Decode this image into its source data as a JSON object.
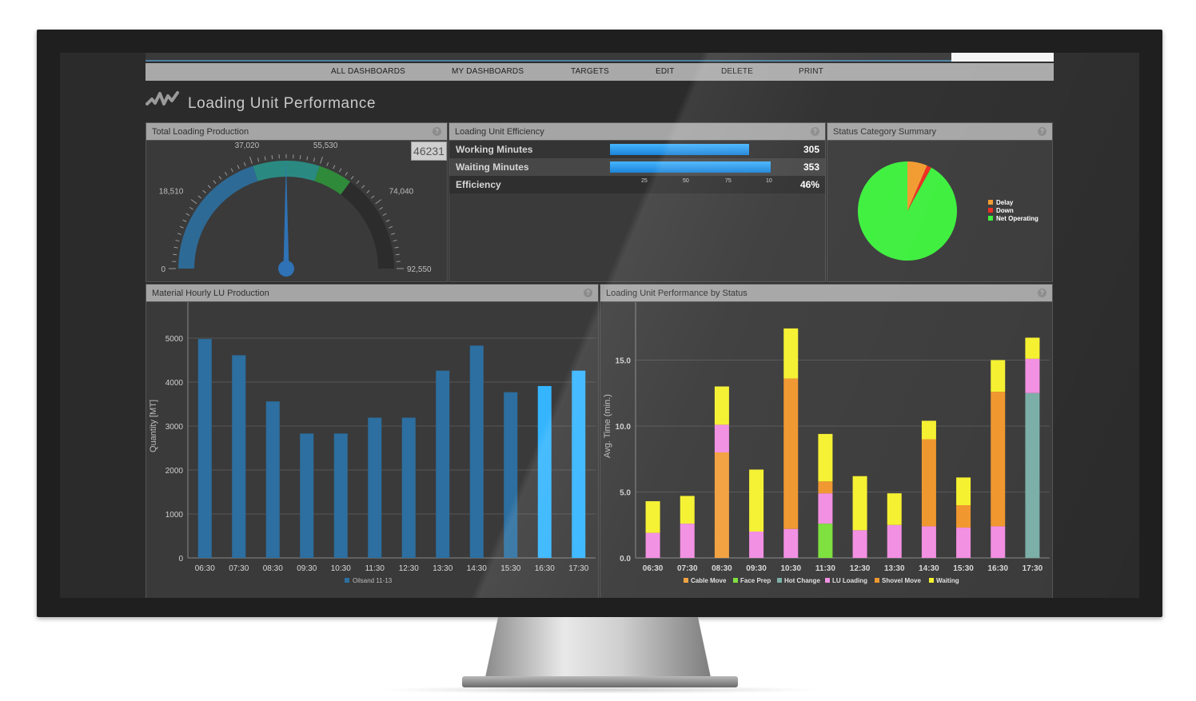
{
  "nav": {
    "items": [
      "ALL DASHBOARDS",
      "MY DASHBOARDS",
      "TARGETS",
      "EDIT",
      "DELETE",
      "PRINT"
    ]
  },
  "page": {
    "title": "Loading Unit Performance"
  },
  "icons": {
    "help": "?",
    "logo": "wave-logo-icon"
  },
  "colors": {
    "bar_blue": "#2c6fa0",
    "bar_blue_highlight": "#35b5ff",
    "status_delay": "#f29a2e",
    "status_down": "#ee2a1e",
    "status_net": "#3cef3c",
    "cable_move": "#f3a03c",
    "face_prep": "#7be03a",
    "hot_change": "#7aaea6",
    "lu_loading": "#f28ee2",
    "shovel_move": "#f0962c",
    "waiting": "#f5f12e"
  },
  "panels": {
    "total": {
      "title": "Total Loading Production",
      "value": "46231"
    },
    "efficiency": {
      "title": "Loading Unit Efficiency",
      "rows": [
        {
          "label": "Working Minutes",
          "value": "305",
          "fraction": 0.85
        },
        {
          "label": "Waiting Minutes",
          "value": "353",
          "fraction": 0.98
        },
        {
          "label": "Efficiency",
          "value": "46%"
        }
      ],
      "scale_ticks": [
        "25",
        "50",
        "75",
        "10"
      ]
    },
    "status": {
      "title": "Status Category Summary",
      "legend": [
        "Delay",
        "Down",
        "Net Operating"
      ]
    },
    "material": {
      "title": "Material Hourly LU Production"
    },
    "performance": {
      "title": "Loading Unit Performance by Status"
    }
  },
  "chart_data": [
    {
      "type": "gauge",
      "title": "Total Loading Production",
      "value": 46231,
      "min": 0,
      "max": 92550,
      "tick_labels": [
        "0",
        "18,510",
        "37,020",
        "55,530",
        "74,040",
        "92,550"
      ],
      "bands": [
        {
          "from": 0,
          "to": 37020,
          "color": "#2e6a96"
        },
        {
          "from": 37020,
          "to": 55530,
          "color": "#2a8a82"
        },
        {
          "from": 55530,
          "to": 65000,
          "color": "#2f8a3a"
        },
        {
          "from": 65000,
          "to": 92550,
          "color": "#2c2c2c"
        }
      ]
    },
    {
      "type": "pie",
      "title": "Status Category Summary",
      "slices": [
        {
          "label": "Delay",
          "value": 6.5,
          "color": "#f29a2e"
        },
        {
          "label": "Down",
          "value": 1.5,
          "color": "#ee2a1e"
        },
        {
          "label": "Net Operating",
          "value": 92,
          "color": "#3cef3c"
        }
      ]
    },
    {
      "type": "bar",
      "title": "Material Hourly LU Production",
      "ylabel": "Quantity [MT]",
      "ylim": [
        0,
        6000
      ],
      "yticks": [
        0,
        1000,
        2000,
        3000,
        4000,
        5000,
        6000
      ],
      "categories": [
        "06:30",
        "07:30",
        "08:30",
        "09:30",
        "10:30",
        "11:30",
        "12:30",
        "13:30",
        "14:30",
        "15:30",
        "16:30",
        "17:30"
      ],
      "series": [
        {
          "name": "Oilsand 11-13",
          "values": [
            4980,
            4610,
            3560,
            2830,
            2830,
            3190,
            3190,
            4260,
            4830,
            3770,
            3910,
            4260
          ]
        }
      ],
      "legend": "bottom"
    },
    {
      "type": "bar",
      "stacked": true,
      "title": "Loading Unit Performance by Status",
      "ylabel": "Avg. Time (min.)",
      "ylim": [
        0,
        20
      ],
      "yticks": [
        "0.0",
        "5.0",
        "10.0",
        "15.0",
        "20.0"
      ],
      "categories": [
        "06:30",
        "07:30",
        "08:30",
        "09:30",
        "10:30",
        "11:30",
        "12:30",
        "13:30",
        "14:30",
        "15:30",
        "16:30",
        "17:30"
      ],
      "series": [
        {
          "name": "Cable Move",
          "color": "#f3a03c",
          "values": [
            0,
            0,
            8.0,
            0,
            0,
            0,
            0,
            0,
            0,
            0,
            0,
            0
          ]
        },
        {
          "name": "Face Prep",
          "color": "#7be03a",
          "values": [
            0,
            0,
            0,
            0,
            0,
            2.6,
            0,
            0,
            0,
            0,
            0,
            0
          ]
        },
        {
          "name": "Hot Change",
          "color": "#7aaea6",
          "values": [
            0,
            0,
            0,
            0,
            0,
            0,
            0,
            0,
            0,
            0,
            0,
            12.5
          ]
        },
        {
          "name": "LU Loading",
          "color": "#f28ee2",
          "values": [
            1.9,
            2.6,
            2.1,
            2.0,
            2.2,
            2.3,
            2.1,
            2.5,
            2.4,
            2.3,
            2.4,
            2.6
          ]
        },
        {
          "name": "Shovel Move",
          "color": "#f0962c",
          "values": [
            0,
            0,
            0,
            0,
            11.4,
            0.9,
            0,
            0,
            6.6,
            1.7,
            10.2,
            0
          ]
        },
        {
          "name": "Waiting",
          "color": "#f5f12e",
          "values": [
            2.4,
            2.1,
            2.9,
            4.7,
            3.8,
            3.6,
            4.1,
            2.4,
            1.4,
            2.1,
            2.4,
            1.6
          ]
        }
      ],
      "legend": "bottom"
    }
  ]
}
